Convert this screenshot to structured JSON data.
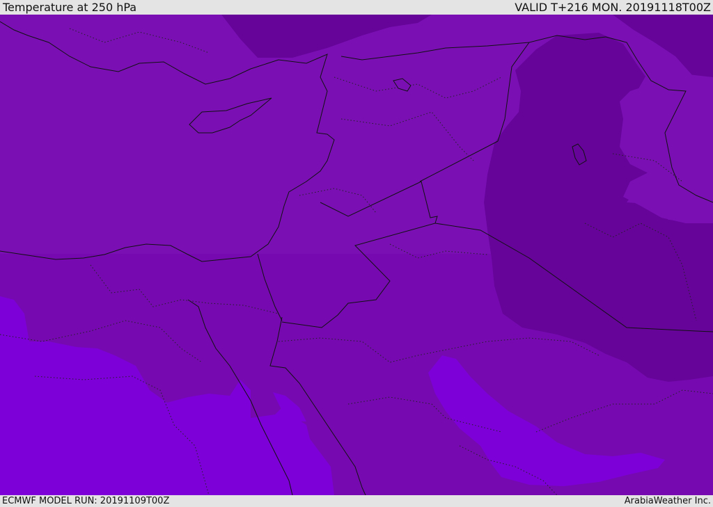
{
  "header": {
    "title": "Temperature at 250 hPa",
    "valid": "VALID T+216 MON. 20191118T00Z"
  },
  "footer": {
    "model_run": "ECMWF MODEL RUN: 20191109T00Z",
    "credit": "ArabiaWeather Inc."
  },
  "map": {
    "palette": {
      "zone_base": "#7a10b4",
      "zone_dark": "#66049a",
      "zone_mid": "#760ab0",
      "zone_light": "#7d00d8",
      "border": "#111111"
    }
  }
}
